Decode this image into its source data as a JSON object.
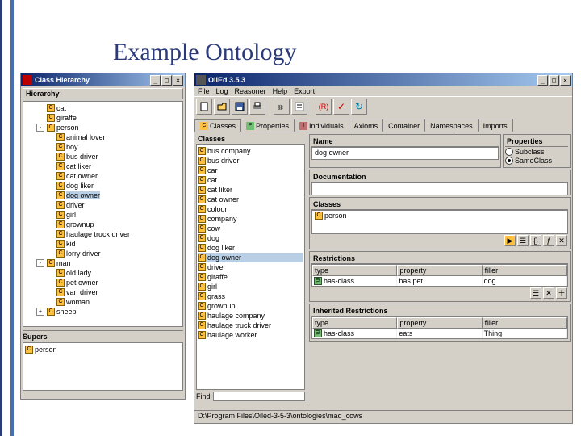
{
  "slide": {
    "title": "Example Ontology"
  },
  "hierarchy_window": {
    "title": "Class Hierarchy",
    "section": "Hierarchy",
    "tree": [
      {
        "lvl": 1,
        "box": "",
        "lbl": "cat"
      },
      {
        "lvl": 1,
        "box": "",
        "lbl": "giraffe"
      },
      {
        "lvl": 1,
        "box": "-",
        "lbl": "person"
      },
      {
        "lvl": 2,
        "box": "",
        "lbl": "animal lover"
      },
      {
        "lvl": 2,
        "box": "",
        "lbl": "boy"
      },
      {
        "lvl": 2,
        "box": "",
        "lbl": "bus driver"
      },
      {
        "lvl": 2,
        "box": "",
        "lbl": "cat liker"
      },
      {
        "lvl": 2,
        "box": "",
        "lbl": "cat owner"
      },
      {
        "lvl": 2,
        "box": "",
        "lbl": "dog liker"
      },
      {
        "lvl": 2,
        "box": "",
        "lbl": "dog owner",
        "sel": true
      },
      {
        "lvl": 2,
        "box": "",
        "lbl": "driver"
      },
      {
        "lvl": 2,
        "box": "",
        "lbl": "girl"
      },
      {
        "lvl": 2,
        "box": "",
        "lbl": "grownup"
      },
      {
        "lvl": 2,
        "box": "",
        "lbl": "haulage truck driver"
      },
      {
        "lvl": 2,
        "box": "",
        "lbl": "kid"
      },
      {
        "lvl": 2,
        "box": "",
        "lbl": "lorry driver"
      },
      {
        "lvl": 1,
        "box": "-",
        "lbl": "man"
      },
      {
        "lvl": 2,
        "box": "",
        "lbl": "old lady"
      },
      {
        "lvl": 2,
        "box": "",
        "lbl": "pet owner"
      },
      {
        "lvl": 2,
        "box": "",
        "lbl": "van driver"
      },
      {
        "lvl": 2,
        "box": "",
        "lbl": "woman"
      },
      {
        "lvl": 1,
        "box": "+",
        "lbl": "sheep"
      }
    ],
    "supers_label": "Supers",
    "supers": [
      "person"
    ]
  },
  "oiled_window": {
    "title": "OilEd 3.5.3",
    "menu": [
      "File",
      "Log",
      "Reasoner",
      "Help",
      "Export"
    ],
    "tabs": [
      {
        "badge": "C",
        "cls": "bC",
        "label": "Classes",
        "active": true
      },
      {
        "badge": "P",
        "cls": "bP",
        "label": "Properties"
      },
      {
        "badge": "I",
        "cls": "bI",
        "label": "Individuals"
      },
      {
        "badge": "",
        "cls": "",
        "label": "Axioms"
      },
      {
        "badge": "",
        "cls": "",
        "label": "Container"
      },
      {
        "badge": "",
        "cls": "",
        "label": "Namespaces"
      },
      {
        "badge": "",
        "cls": "",
        "label": "Imports"
      }
    ],
    "classes_label": "Classes",
    "classes": [
      "bus company",
      "bus driver",
      "car",
      "cat",
      "cat liker",
      "cat owner",
      "colour",
      "company",
      "cow",
      "dog",
      "dog liker",
      "dog owner",
      "driver",
      "giraffe",
      "girl",
      "grass",
      "grownup",
      "haulage company",
      "haulage truck driver",
      "haulage worker"
    ],
    "selected_class_idx": 11,
    "find_label": "Find",
    "name_label": "Name",
    "name_value": "dog owner",
    "props_label": "Properties",
    "props_radio": [
      {
        "label": "Subclass",
        "on": false
      },
      {
        "label": "SameClass",
        "on": true
      }
    ],
    "doc_label": "Documentation",
    "cls_panel_label": "Classes",
    "cls_panel_values": [
      "person"
    ],
    "restr_label": "Restrictions",
    "restr_cols": [
      "type",
      "property",
      "filler"
    ],
    "restr_rows": [
      [
        "has-class",
        "has pet",
        "dog"
      ]
    ],
    "inh_label": "Inherited Restrictions",
    "inh_cols": [
      "type",
      "property",
      "filler"
    ],
    "inh_rows": [
      [
        "has-class",
        "eats",
        "Thing"
      ]
    ],
    "status": "D:\\Program Files\\Oiled-3-5-3\\ontologies\\mad_cows"
  }
}
